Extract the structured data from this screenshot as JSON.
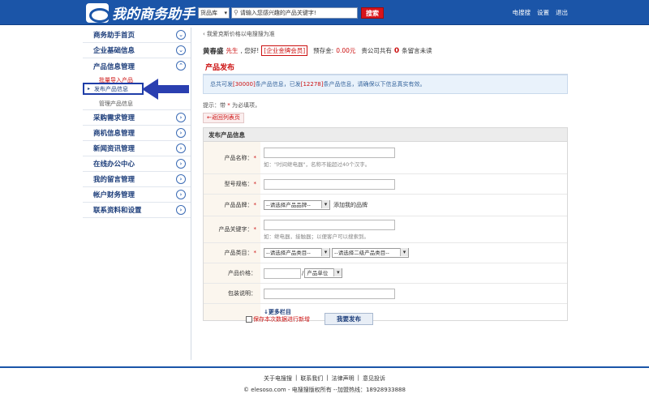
{
  "header": {
    "logo_text": "我的商务助手",
    "search_scope": "货品库",
    "search_placeholder": "请输入您感兴趣的产品关键字!",
    "search_button": "搜索",
    "links": [
      "电搜搜",
      "设置",
      "退出"
    ]
  },
  "sidebar": {
    "items": [
      {
        "label": "商务助手首页"
      },
      {
        "label": "企业基础信息"
      },
      {
        "label": "产品信息管理"
      }
    ],
    "sub_items": [
      "批量导入产品",
      "发布产品信息",
      "管理产品信息"
    ],
    "items_after": [
      {
        "label": "采购需求管理"
      },
      {
        "label": "商机信息管理"
      },
      {
        "label": "新闻资讯管理"
      },
      {
        "label": "在线办公中心"
      },
      {
        "label": "我的留言管理"
      },
      {
        "label": "帐户财务管理"
      },
      {
        "label": "联系资料和设置"
      }
    ]
  },
  "main": {
    "breadcrumb": "我爱克斯价格以电搜搜为准",
    "welcome": {
      "name": "黄春盛",
      "salutation": "先生",
      "greeting": ", 您好!",
      "member_tag": "[企业金牌会员]",
      "deposit_label": "预存金:",
      "deposit_value": "0.00元",
      "msg_prefix": "贵公司共有",
      "msg_count": "0",
      "msg_suffix": "条留言未读"
    },
    "section_title": "产品发布",
    "notice": {
      "p1": "总共可发",
      "total": "[30000]",
      "p2": "条产品信息，已发",
      "used": "[12278]",
      "p3": "条产品信息，请确保以下信息真实有效。"
    },
    "hint_prefix": "提示：带",
    "hint_star": "*",
    "hint_suffix": "为必填项，",
    "back_link": "←返回列表页",
    "form": {
      "title": "发布产品信息",
      "fields": {
        "name": {
          "label": "产品名称：",
          "note": "如：\"时间继电器\"，名称不能超过40个汉字。"
        },
        "model": {
          "label": "型号规格："
        },
        "brand": {
          "label": "产品品牌：",
          "select": "--请选择产品品牌--",
          "link": "添加我的品牌"
        },
        "keywords": {
          "label": "产品关键字：",
          "note": "如：继电器，接触器；以便客户可以搜索到。"
        },
        "category": {
          "label": "产品类目：",
          "select1": "--请选择产品类目--",
          "select2": "--请选择二级产品类目--"
        },
        "price": {
          "label": "产品价格：",
          "sep": "/",
          "unit": "产品单位"
        },
        "package": {
          "label": "包装说明："
        }
      },
      "more": "更多栏目"
    },
    "save_checkbox_label": "保存本次数据进行新增",
    "submit": "我要发布"
  },
  "footer": {
    "links": [
      "关于电搜搜",
      "|",
      "联系我们",
      "|",
      "法律声明",
      "|",
      "意见投诉"
    ],
    "copyright": "© elesoso.com - 电搜搜版权所有 --加盟热线：18928933888"
  }
}
